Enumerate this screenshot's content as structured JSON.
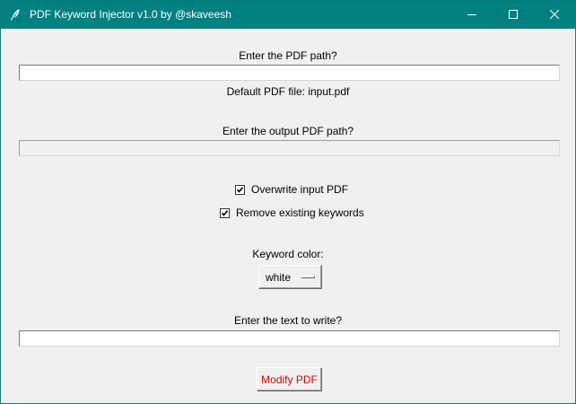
{
  "window": {
    "title": "PDF Keyword Injector v1.0 by @skaveesh",
    "titlebar_color": "#008080",
    "controls": {
      "minimize_icon": "minimize-icon",
      "maximize_icon": "maximize-icon",
      "close_icon": "close-icon"
    }
  },
  "form": {
    "pdf_path_label": "Enter the PDF path?",
    "pdf_path_value": "",
    "default_pdf_note": "Default PDF file: input.pdf",
    "output_path_label": "Enter the output PDF path?",
    "output_path_value": "",
    "output_path_disabled": true,
    "overwrite_checkbox": {
      "label": "Overwrite input PDF",
      "checked": true
    },
    "remove_keywords_checkbox": {
      "label": "Remove existing keywords",
      "checked": true
    },
    "keyword_color_label": "Keyword color:",
    "keyword_color_selected": "white",
    "text_label": "Enter the text to write?",
    "text_value": "",
    "modify_button_label": "Modify PDF",
    "modify_button_color": "#d40000"
  }
}
